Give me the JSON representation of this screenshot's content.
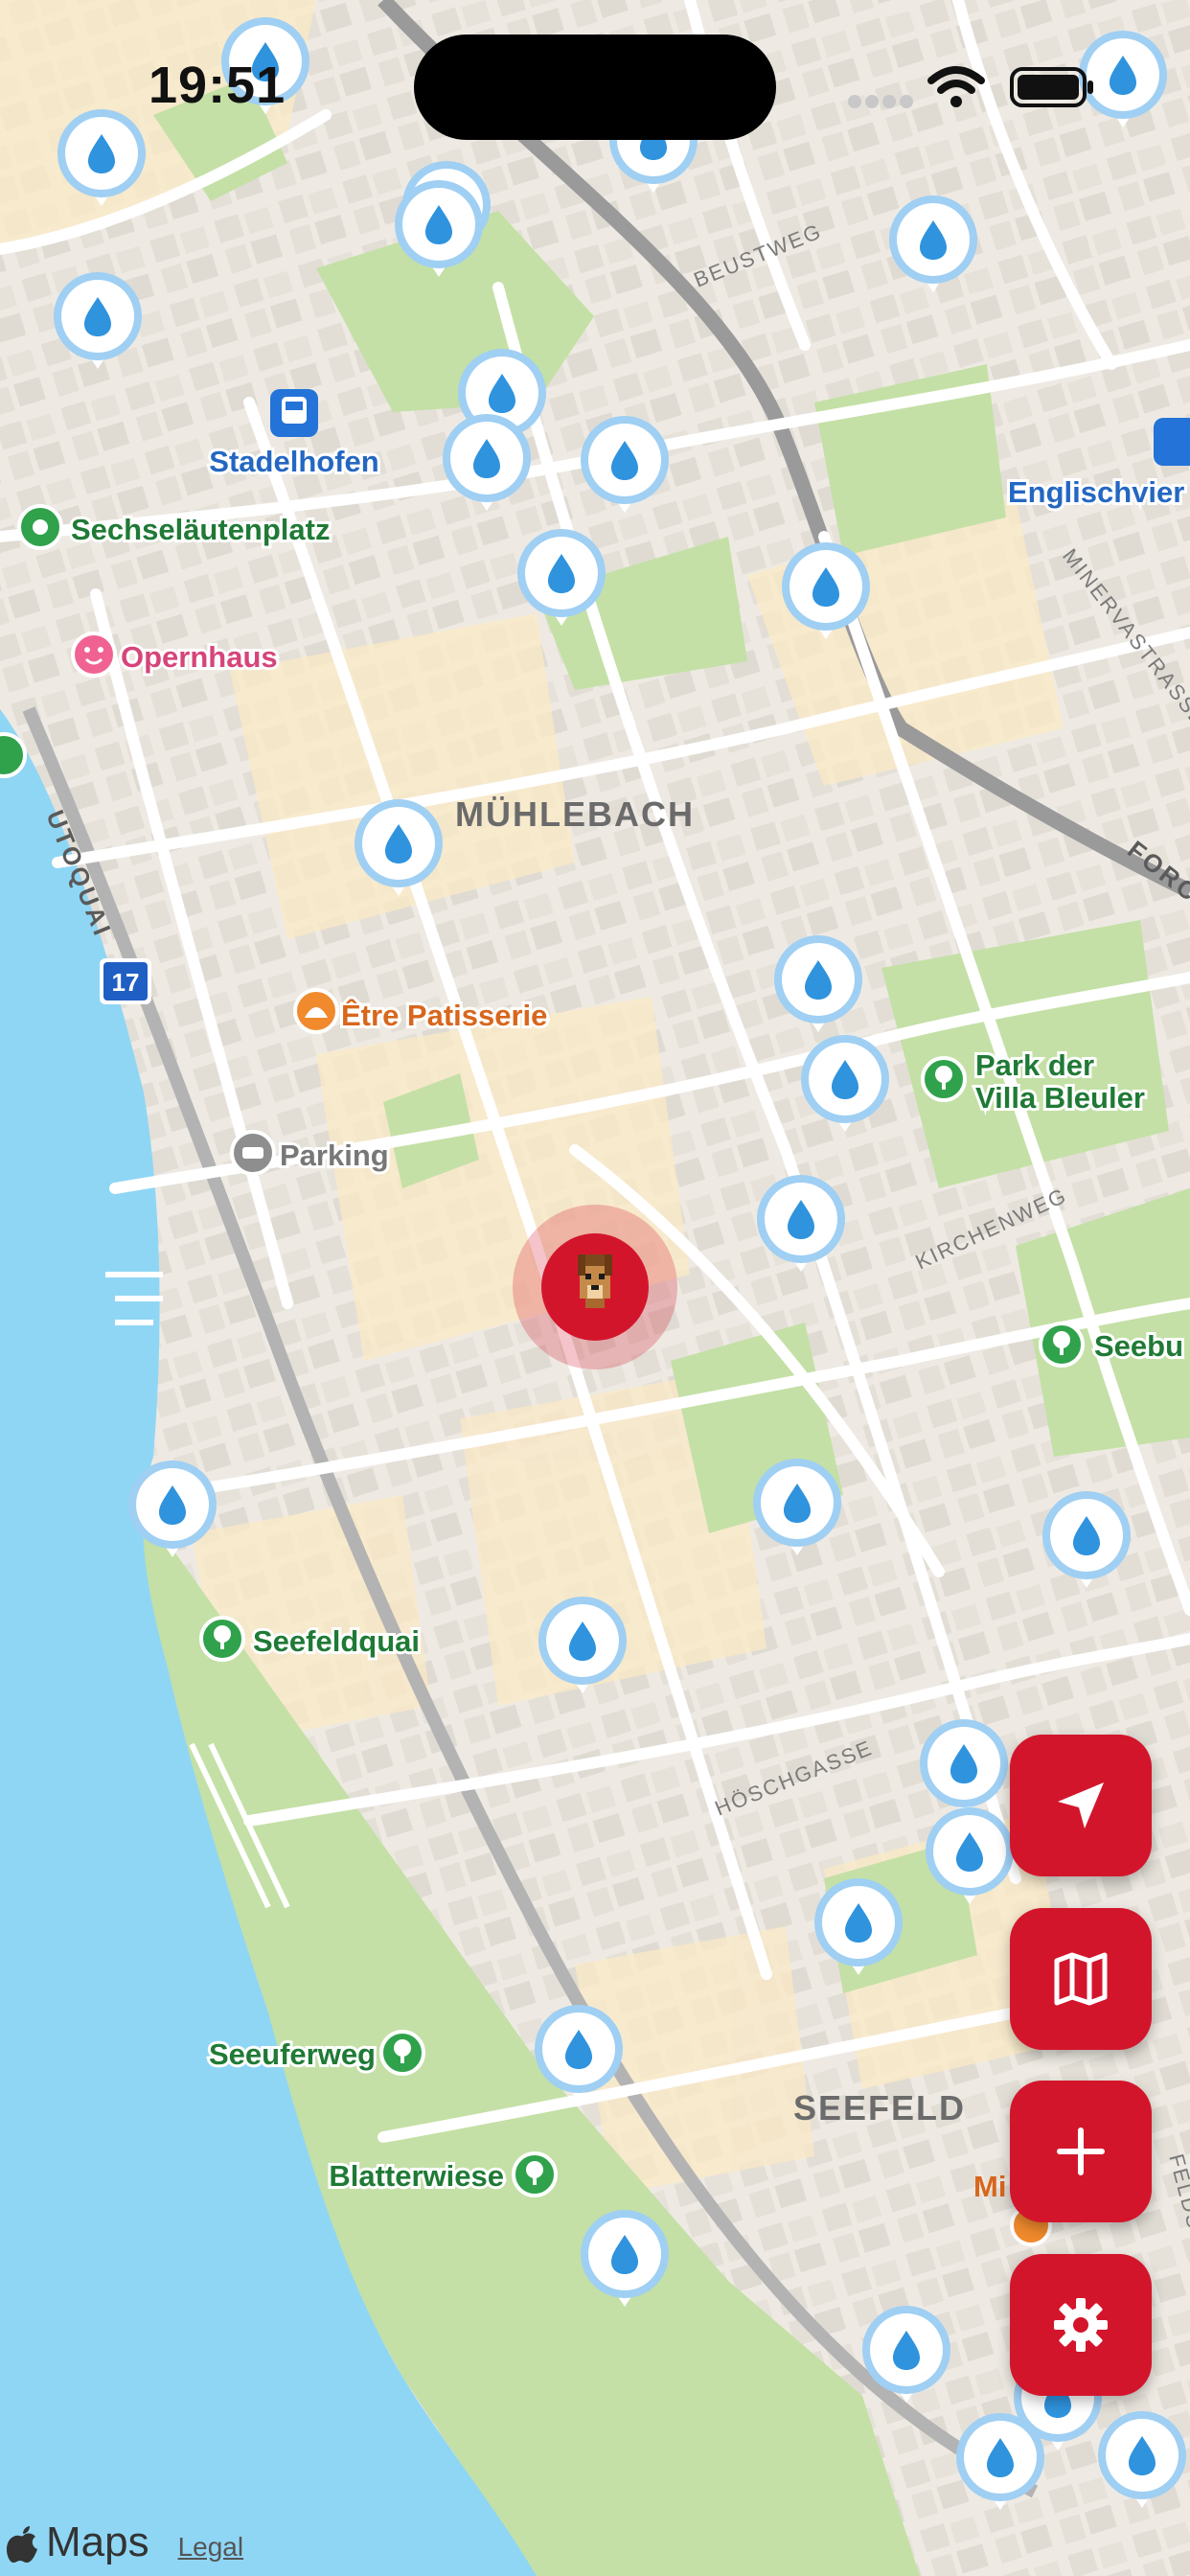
{
  "status_bar": {
    "time": "19:51"
  },
  "map": {
    "district_labels": {
      "muehlebach": "MÜHLEBACH",
      "seefeld": "SEEFELD"
    },
    "street_labels": {
      "beustweg": "BEUSTWEG",
      "utoquai": "UTOQUAI",
      "minervastrasse": "MINERVASTRASSE",
      "kirchenweg": "KIRCHENWEG",
      "hoschgasse": "HÖSCHGASSE",
      "forch": "FORCH",
      "feldstrasse": "FELDS"
    },
    "poi_labels": {
      "stadelhofen": "Stadelhofen",
      "englischviertel": "Englischvier",
      "sechselaeutenplatz": "Sechseläutenplatz",
      "opernhaus": "Opernhaus",
      "etre_patisserie": "Être Patisserie",
      "parking": "Parking",
      "park_villa_bleuler_1": "Park der",
      "park_villa_bleuler_2": "Villa Bleuler",
      "seebu": "Seebu",
      "seefeldquai": "Seefeldquai",
      "seeuferweg": "Seeuferweg",
      "blatterwiese": "Blatterwiese",
      "mi": "Mi"
    },
    "route_badge": "17",
    "marker_icon": "water-drop-icon",
    "user_marker_icon": "dog-icon"
  },
  "colors": {
    "accent": "#d3152c",
    "land": "#f3f0e9",
    "water": "#8fd6f5",
    "park": "#c4e0a6",
    "marker_ring": "#9fcff3",
    "drop": "#2f93de"
  },
  "controls": {
    "locate": "location-arrow-icon",
    "map_mode": "map-icon",
    "add": "plus-icon",
    "settings": "gear-icon"
  },
  "attribution": {
    "brand": "Maps",
    "legal": "Legal"
  }
}
